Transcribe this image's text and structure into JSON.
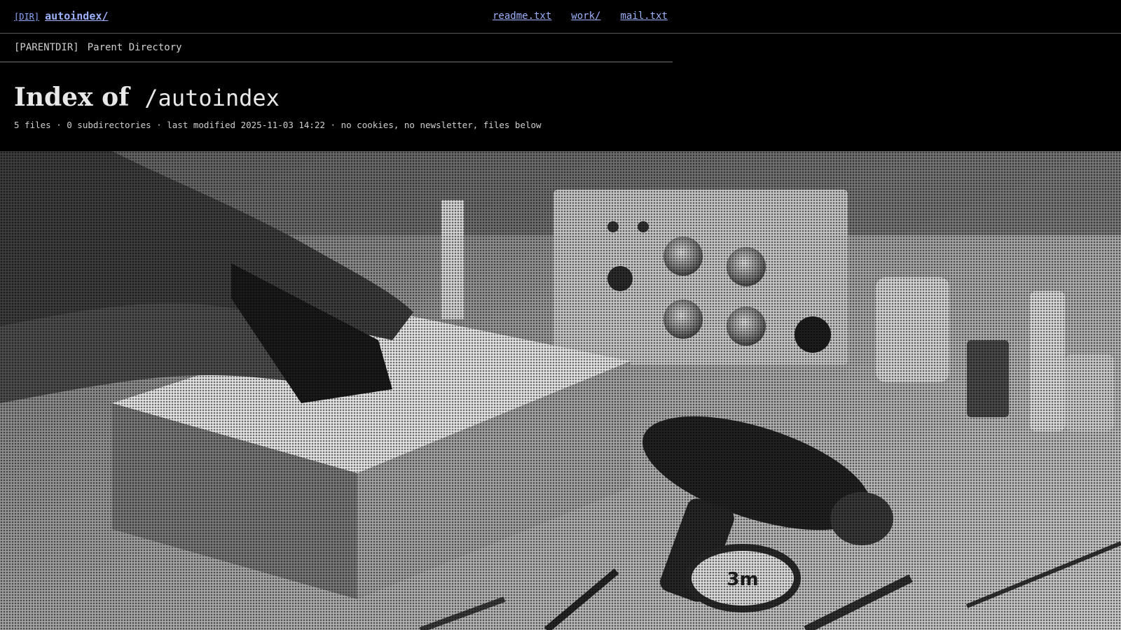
{
  "header": {
    "dir_tag": "[DIR]",
    "brand": "autoindex/",
    "nav": [
      {
        "label": "readme.txt"
      },
      {
        "label": "work/"
      },
      {
        "label": "mail.txt"
      }
    ]
  },
  "parent": {
    "tag": "[PARENTDIR]",
    "label": "Parent Directory"
  },
  "page": {
    "title_prefix": "Index of",
    "title_path": "/autoindex",
    "meta": "5 files · 0 subdirectories · last modified 2025-11-03 14:22 · no cookies, no newsletter, files below"
  },
  "photo": {
    "tape_label": "3m"
  }
}
